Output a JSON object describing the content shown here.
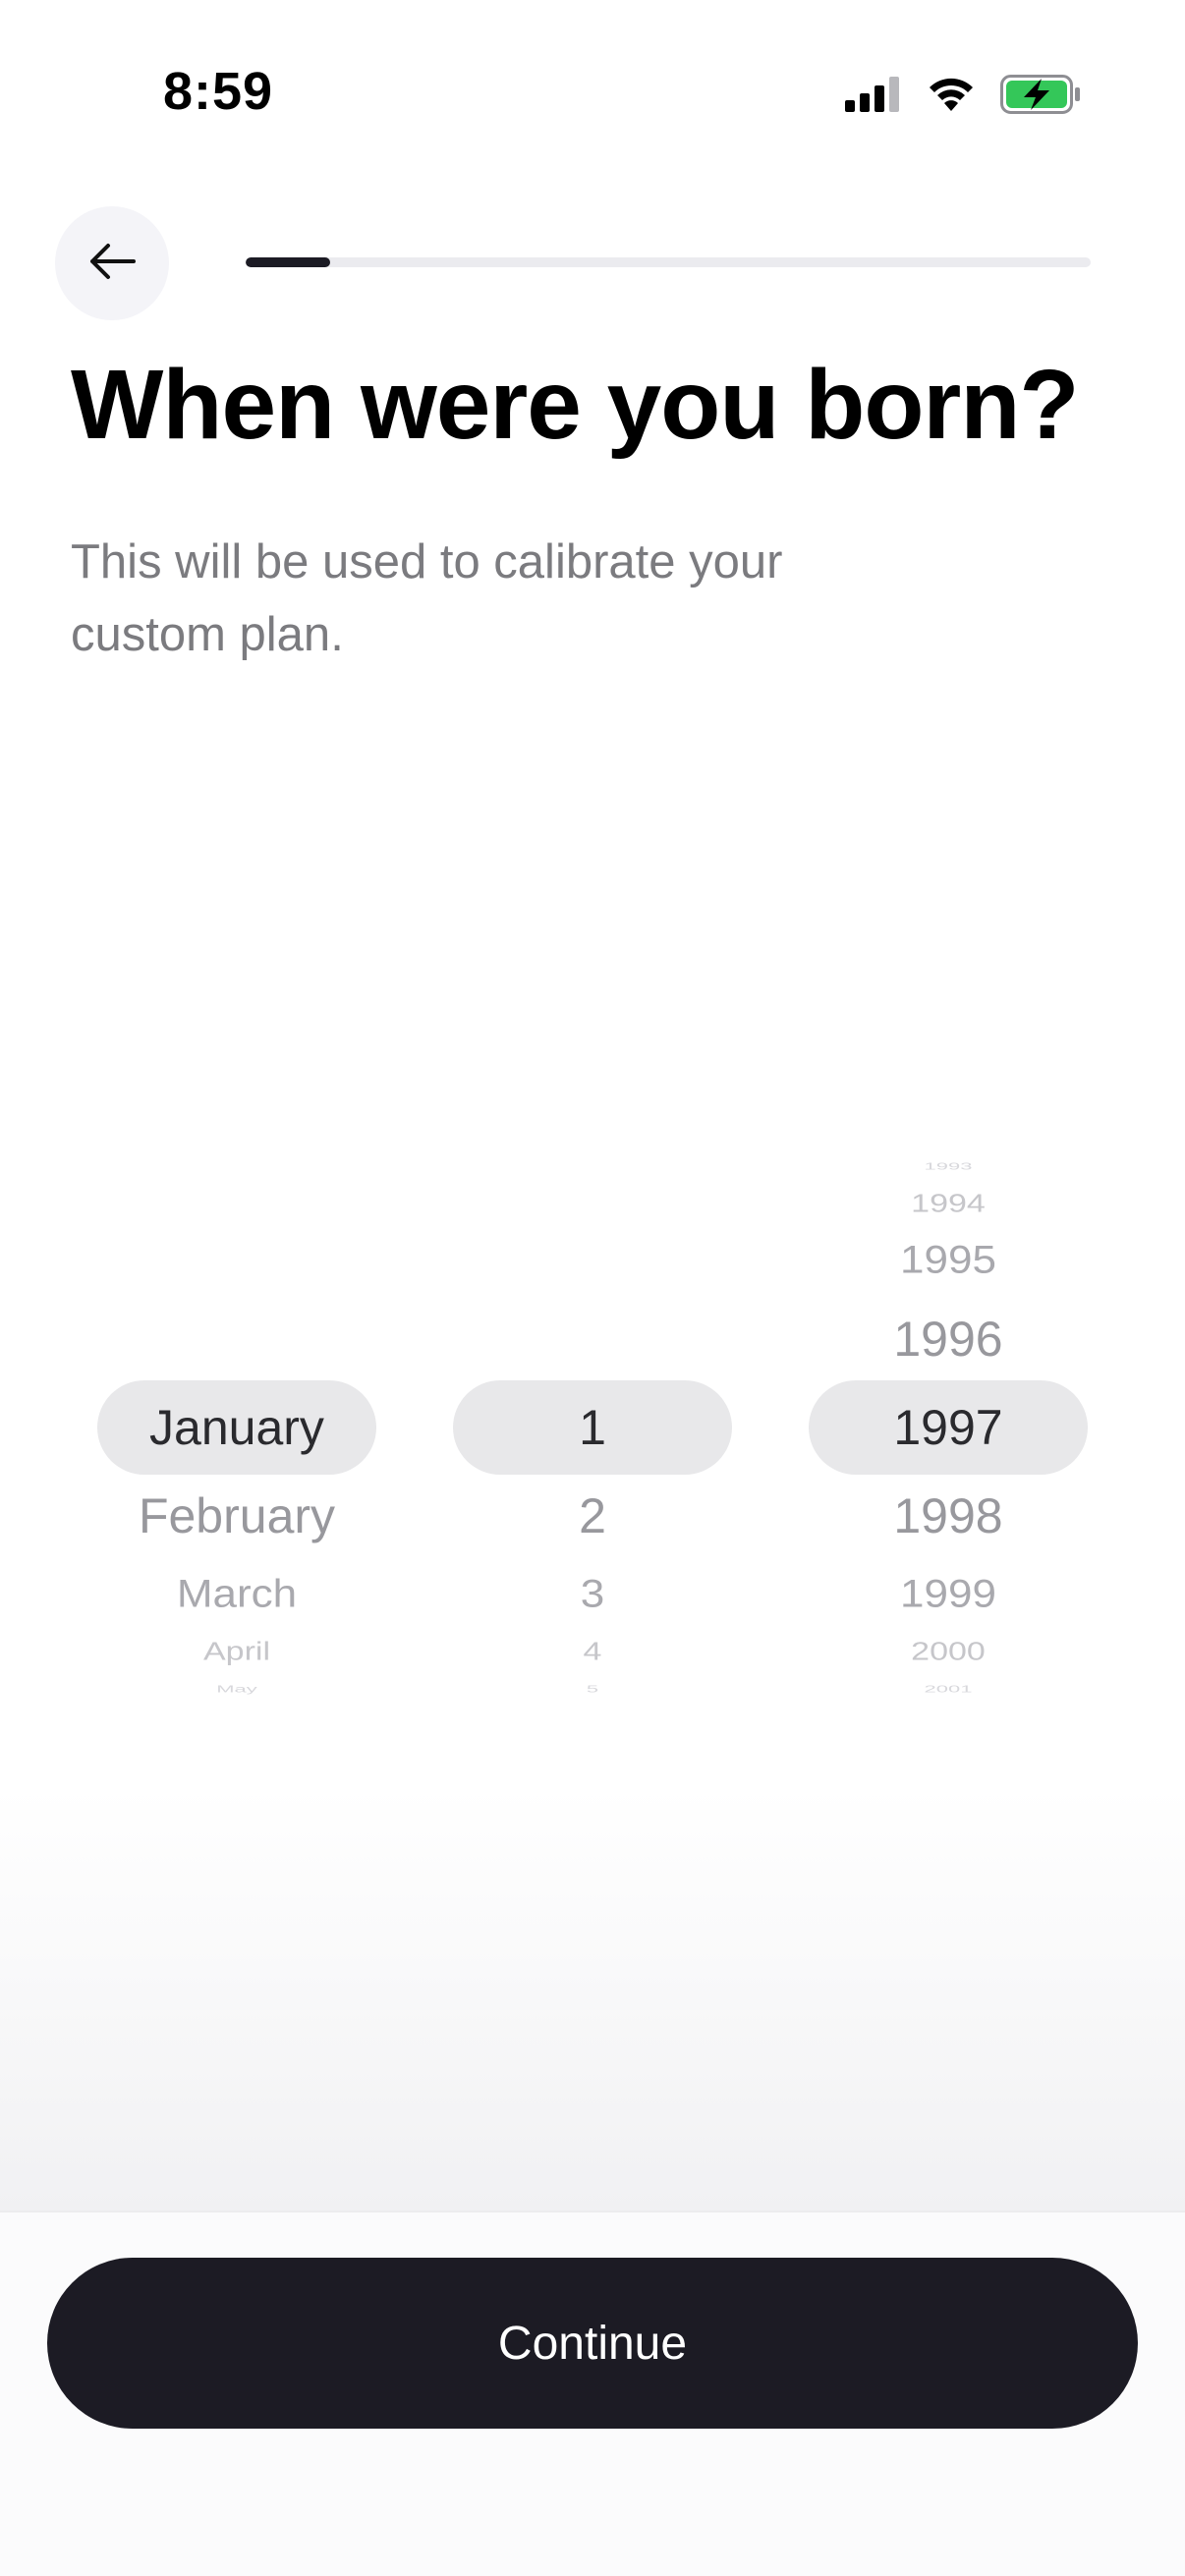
{
  "status_bar": {
    "time": "8:59",
    "icons": [
      "cellular-signal-icon",
      "wifi-icon",
      "battery-charging-icon"
    ],
    "battery_color": "#34c759"
  },
  "header": {
    "back_icon": "arrow-left-icon",
    "progress_fraction": 0.1
  },
  "title": "When were you born?",
  "subtitle": "This will be used to calibrate your custom plan.",
  "picker": {
    "months": [
      "January",
      "February",
      "March",
      "April",
      "May"
    ],
    "days": [
      "1",
      "2",
      "3",
      "4",
      "5"
    ],
    "years": [
      "1993",
      "1994",
      "1995",
      "1996",
      "1997",
      "1998",
      "1999",
      "2000",
      "2001"
    ],
    "selected": {
      "month": "January",
      "day": "1",
      "year": "1997"
    }
  },
  "continue_label": "Continue",
  "colors": {
    "primary": "#1c1b24",
    "highlight": "#e8e8ea",
    "subtitle": "#7b7b7f"
  }
}
